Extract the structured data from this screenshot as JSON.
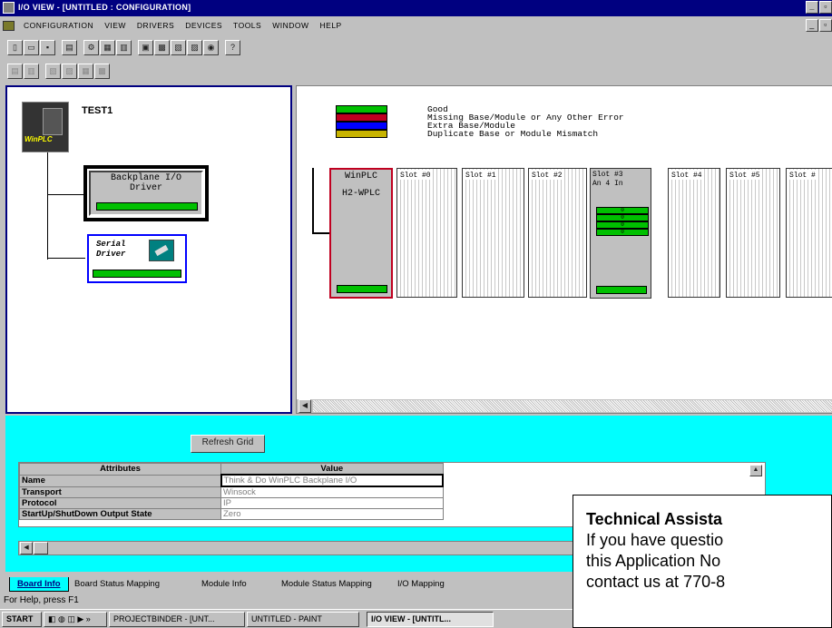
{
  "title": "I/O View - [Untitled : Configuration]",
  "menu": [
    "Configuration",
    "View",
    "Drivers",
    "Devices",
    "Tools",
    "Window",
    "Help"
  ],
  "tree": {
    "plc_name": "TEST1",
    "plc_badge": "WinPLC",
    "backplane_line1": "Backplane I/O",
    "backplane_line2": "Driver",
    "serial_line1": "Serial",
    "serial_line2": "Driver"
  },
  "legend": [
    {
      "label": "Good",
      "color": "#00c000"
    },
    {
      "label": "Missing Base/Module or Any Other Error",
      "color": "#c00020"
    },
    {
      "label": "Extra Base/Module",
      "color": "#0000ff"
    },
    {
      "label": "Duplicate Base or Module Mismatch",
      "color": "#c8b400"
    }
  ],
  "cpu": {
    "name": "WinPLC",
    "model": "H2-WPLC"
  },
  "slots": [
    "Slot #0",
    "Slot #1",
    "Slot #2",
    "Slot #3",
    "Slot #4",
    "Slot #5",
    "Slot #"
  ],
  "slot3_module": "An 4 In",
  "slot3_channels": [
    "0",
    "0",
    "0",
    "0"
  ],
  "refresh_label": "Refresh Grid",
  "grid": {
    "headers": [
      "Attributes",
      "Value"
    ],
    "rows": [
      [
        "Name",
        "Think & Do WinPLC Backplane I/O"
      ],
      [
        "Transport",
        "Winsock"
      ],
      [
        "Protocol",
        "IP"
      ],
      [
        "StartUp/ShutDown Output State",
        "Zero"
      ]
    ]
  },
  "tabs": [
    "Board Info",
    "Board Status Mapping",
    "Module Info",
    "Module Status Mapping",
    "I/O Mapping"
  ],
  "status": "For Help, press F1",
  "taskbar": {
    "start": "Start",
    "items": [
      "ProjectBinder - [Unt...",
      "untitled - Paint",
      "I/O View - [Untitl..."
    ]
  },
  "overlay": {
    "heading": "Technical Assista",
    "line1": "If you have questio",
    "line2": "this Application No",
    "line3": "contact us at 770-8"
  }
}
